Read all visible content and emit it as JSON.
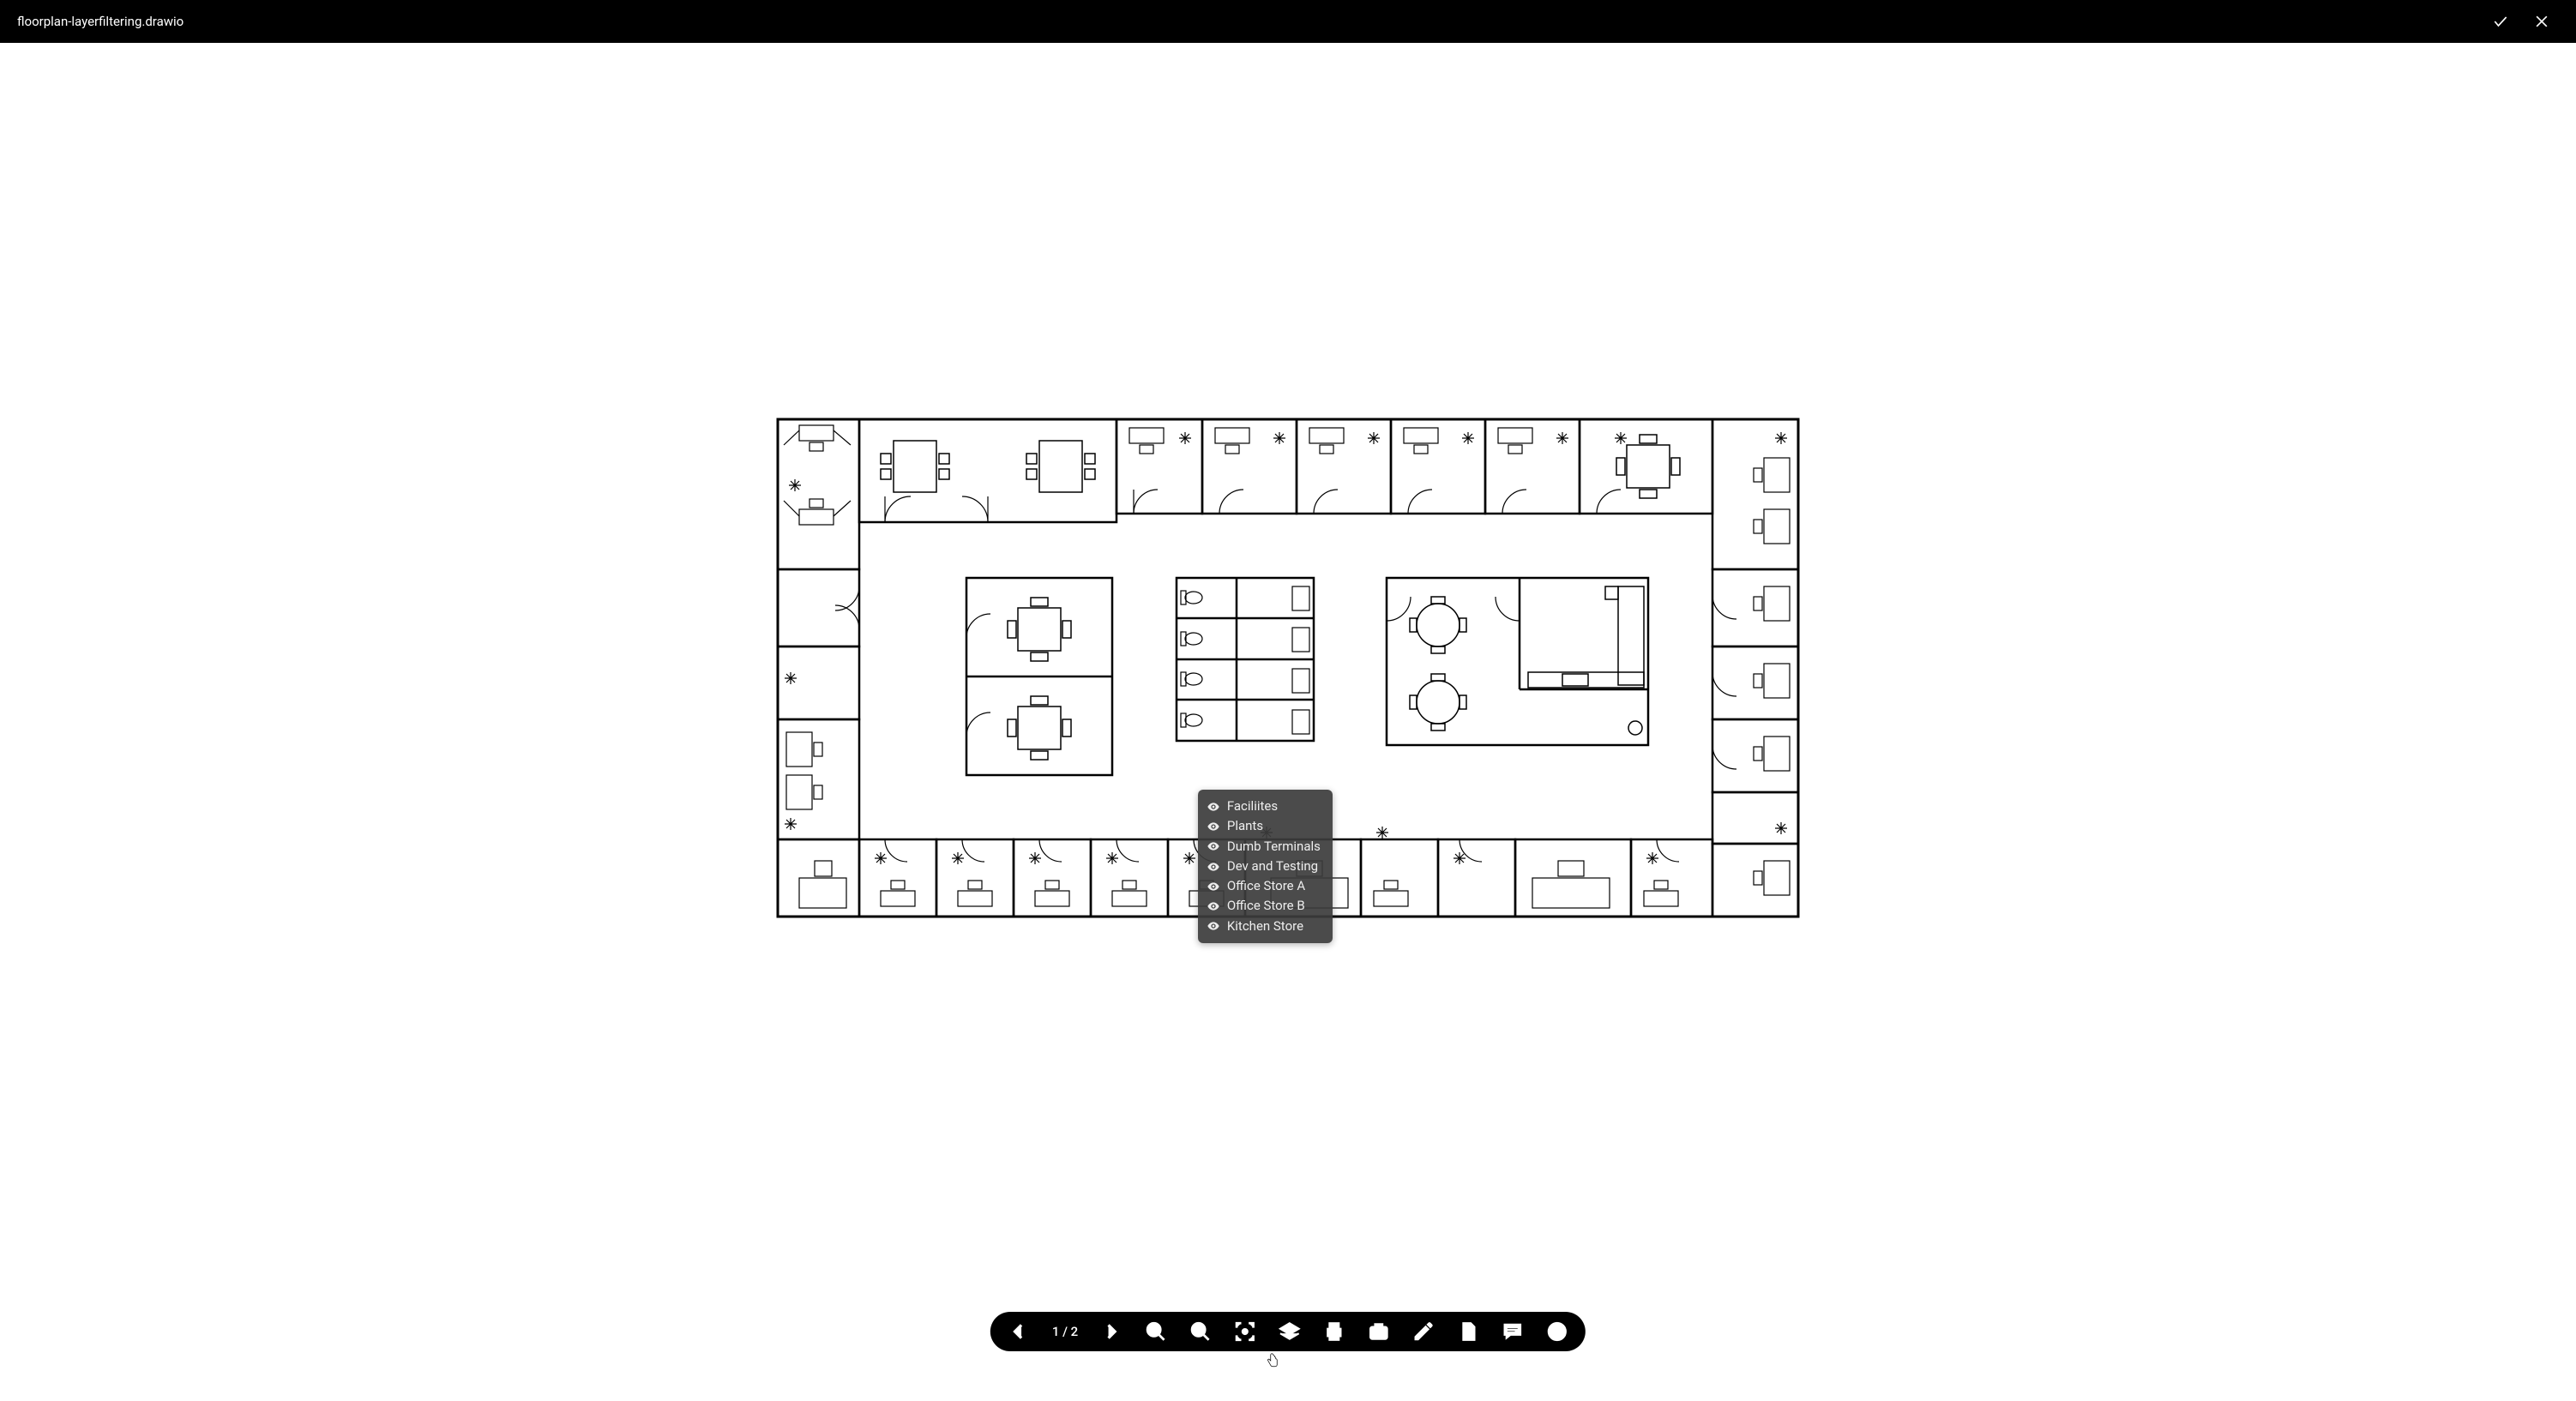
{
  "header": {
    "title": "floorplan-layerfiltering.drawio",
    "confirm_label": "Confirm",
    "close_label": "Close"
  },
  "layers_popup": {
    "items": [
      {
        "label": "Faciliites",
        "visible": true
      },
      {
        "label": "Plants",
        "visible": true
      },
      {
        "label": "Dumb Terminals",
        "visible": true
      },
      {
        "label": "Dev and Testing",
        "visible": true
      },
      {
        "label": "Office Store A",
        "visible": true
      },
      {
        "label": "Office Store B",
        "visible": true
      },
      {
        "label": "Kitchen Store",
        "visible": true
      }
    ]
  },
  "toolbar": {
    "prev_page": "Previous page",
    "next_page": "Next page",
    "page_indicator": "1 / 2",
    "zoom_out": "Zoom out",
    "zoom_in": "Zoom in",
    "fit": "Fit to screen",
    "layers": "Layers",
    "print": "Print",
    "export_image": "Export image",
    "edit": "Edit",
    "copy": "Copy",
    "comments": "Comments",
    "close": "Close viewer"
  },
  "diagram": {
    "type": "floorplan",
    "pages": 2,
    "current_page": 1,
    "description": "Office floor plan with perimeter private offices, two central meeting rooms, restrooms block, and a kitchen/break area."
  }
}
